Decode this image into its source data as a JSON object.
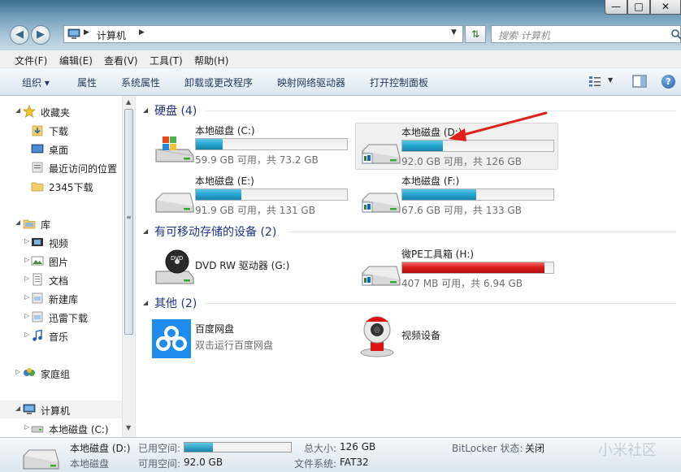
{
  "window": {
    "min_glyph": "—",
    "max_glyph": "□",
    "close_glyph": "✕"
  },
  "address": {
    "location": "计算机",
    "search_placeholder": "搜索 计算机"
  },
  "menu": [
    "文件(F)",
    "编辑(E)",
    "查看(V)",
    "工具(T)",
    "帮助(H)"
  ],
  "toolbar": {
    "organize": "组织 ▾",
    "properties": "属性",
    "system_properties": "系统属性",
    "uninstall": "卸载或更改程序",
    "map_drive": "映射网络驱动器",
    "control_panel": "打开控制面板",
    "help_glyph": "?"
  },
  "nav": {
    "favorites": "收藏夹",
    "downloads": "下载",
    "desktop": "桌面",
    "recent": "最近访问的位置",
    "dl2345": "2345下载",
    "libraries": "库",
    "videos": "视频",
    "pictures": "图片",
    "documents": "文档",
    "new_library": "新建库",
    "thunder": "迅雷下载",
    "music": "音乐",
    "homegroup": "家庭组",
    "computer": "计算机",
    "drive_c": "本地磁盘 (C:)"
  },
  "groups": {
    "hard_disks": "硬盘 (4)",
    "removable": "有可移动存储的设备 (2)",
    "other": "其他 (2)"
  },
  "drives": [
    {
      "name": "本地磁盘 (C:)",
      "detail": "59.9 GB 可用，共 73.2 GB",
      "used_fraction": 0.18
    },
    {
      "name": "本地磁盘 (D:)",
      "detail": "92.0 GB 可用，共 126 GB",
      "used_fraction": 0.27
    },
    {
      "name": "本地磁盘 (E:)",
      "detail": "91.9 GB 可用，共 131 GB",
      "used_fraction": 0.3
    },
    {
      "name": "本地磁盘 (F:)",
      "detail": "67.6 GB 可用，共 133 GB",
      "used_fraction": 0.49
    }
  ],
  "removable": [
    {
      "name": "DVD RW 驱动器 (G:)",
      "icon_text": "DVD"
    },
    {
      "name": "微PE工具箱 (H:)",
      "detail": "407 MB 可用，共 6.94 GB",
      "used_fraction": 0.94
    }
  ],
  "other": [
    {
      "name": "百度网盘",
      "sub": "双击运行百度网盘"
    },
    {
      "name": "视频设备"
    }
  ],
  "details": {
    "name": "本地磁盘 (D:)",
    "type": "本地磁盘",
    "used_label": "已用空间:",
    "used_fraction": 0.27,
    "free_label": "可用空间:",
    "free_value": "92.0 GB",
    "total_label": "总大小:",
    "total_value": "126 GB",
    "fs_label": "文件系统:",
    "fs_value": "FAT32",
    "bitlocker_label": "BitLocker 状态:",
    "bitlocker_value": "关闭"
  },
  "watermark": "小米社区"
}
